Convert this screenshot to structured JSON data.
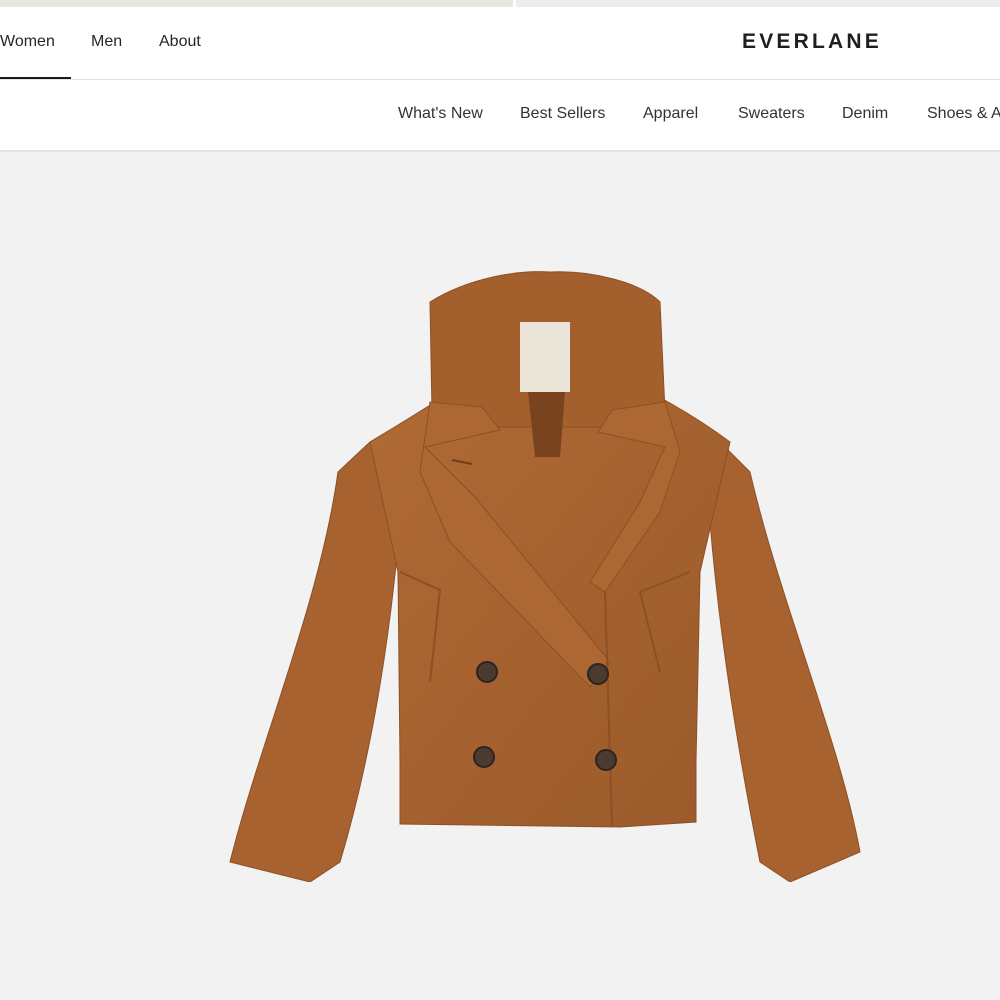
{
  "header": {
    "tabs": [
      {
        "label": "Women",
        "active": true
      },
      {
        "label": "Men",
        "active": false
      },
      {
        "label": "About",
        "active": false
      }
    ],
    "logo": "EVERLANE"
  },
  "categories": [
    "What's New",
    "Best Sellers",
    "Apparel",
    "Sweaters",
    "Denim",
    "Shoes & A"
  ],
  "product": {
    "image": "double-breasted-camel-peacoat",
    "coat_color": "#a8622f"
  }
}
